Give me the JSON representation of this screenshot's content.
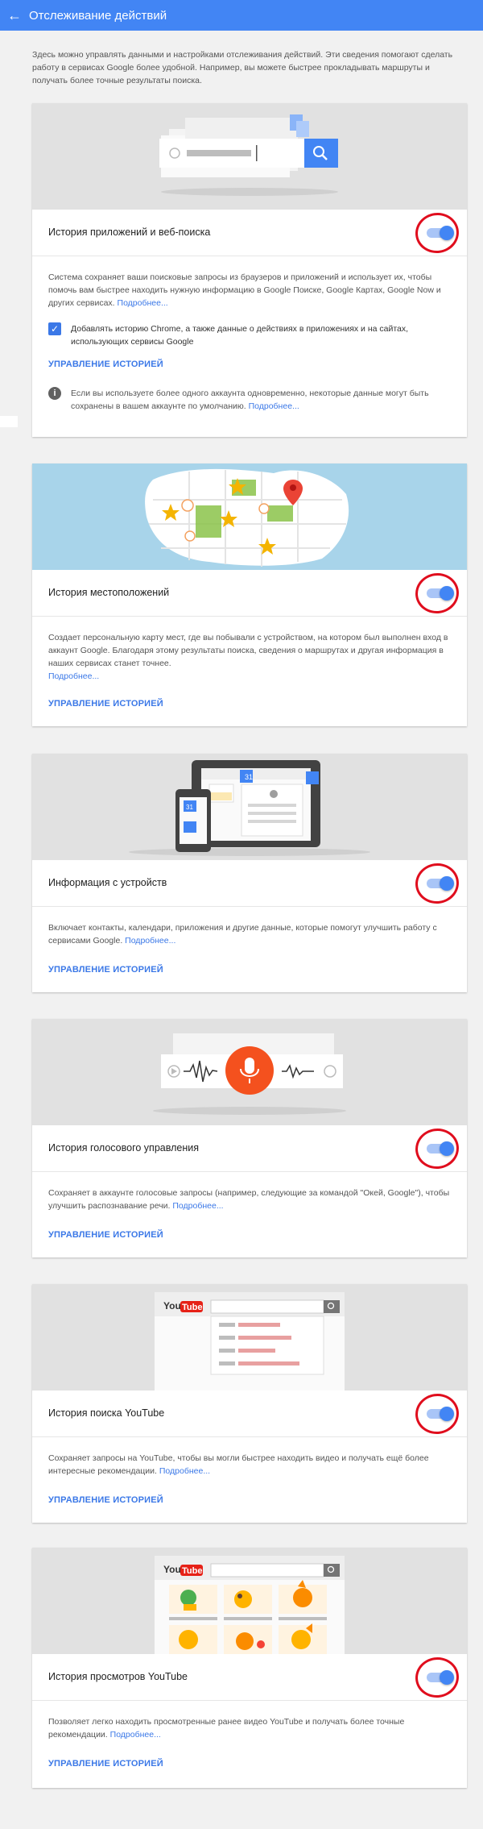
{
  "header": {
    "back_icon": "arrow-left-icon",
    "title": "Отслеживание действий"
  },
  "intro": "Здесь можно управлять данными и настройками отслеживания действий. Эти сведения помогают сделать работу в сервисах Google более удобной. Например, вы можете быстрее прокладывать маршруты и получать более точные результаты поиска.",
  "colors": {
    "accent": "#4285f4",
    "link": "#3b78e7",
    "highlight_ring": "#e00d1d",
    "hero_bg": "#e1e1e1"
  },
  "cards": [
    {
      "title": "История приложений и веб-поиска",
      "toggle_on": true,
      "description": "Система сохраняет ваши поисковые запросы из браузеров и приложений и использует их, чтобы помочь вам быстрее находить нужную информацию в Google Поиске, Google Картах, Google Now и других сервисах. ",
      "more": "Подробнее...",
      "checkbox_checked": true,
      "checkbox_label": "Добавлять историю Chrome, а также данные о действиях в приложениях и на сайтах, использующих сервисы Google",
      "manage": "УПРАВЛЕНИЕ ИСТОРИЕЙ",
      "info_icon": "info-icon",
      "info_text": "Если вы используете более одного аккаунта одновременно, некоторые данные могут быть сохранены в вашем аккаунте по умолчанию. ",
      "info_more": "Подробнее..."
    },
    {
      "title": "История местоположений",
      "toggle_on": true,
      "description": "Создает персональную карту мест, где вы побывали с устройством, на котором был выполнен вход в аккаунт Google. Благодаря этому результаты поиска, сведения о маршрутах и другая информация в наших сервисах станет точнее.",
      "more": "Подробнее...",
      "manage": "УПРАВЛЕНИЕ ИСТОРИЕЙ"
    },
    {
      "title": "Информация с устройств",
      "toggle_on": true,
      "description": "Включает контакты, календари, приложения и другие данные, которые помогут улучшить работу с сервисами Google. ",
      "more": "Подробнее...",
      "manage": "УПРАВЛЕНИЕ ИСТОРИЕЙ",
      "calendar_badge": "31"
    },
    {
      "title": "История голосового управления",
      "toggle_on": true,
      "description": "Сохраняет в аккаунте голосовые запросы (например, следующие за командой \"Окей, Google\"), чтобы улучшить распознавание речи. ",
      "more": "Подробнее...",
      "manage": "УПРАВЛЕНИЕ ИСТОРИЕЙ"
    },
    {
      "title": "История поиска YouTube",
      "toggle_on": true,
      "description": "Сохраняет запросы на YouTube, чтобы вы могли быстрее находить видео и получать ещё более интересные рекомендации. ",
      "more": "Подробнее...",
      "manage": "УПРАВЛЕНИЕ ИСТОРИЕЙ",
      "logo_text": "You",
      "logo_tube": "Tube"
    },
    {
      "title": "История просмотров YouTube",
      "toggle_on": true,
      "description": "Позволяет легко находить просмотренные ранее видео YouTube и получать более точные рекомендации. ",
      "more": "Подробнее...",
      "manage": "УПРАВЛЕНИЕ ИСТОРИЕЙ",
      "logo_text": "You",
      "logo_tube": "Tube"
    }
  ]
}
